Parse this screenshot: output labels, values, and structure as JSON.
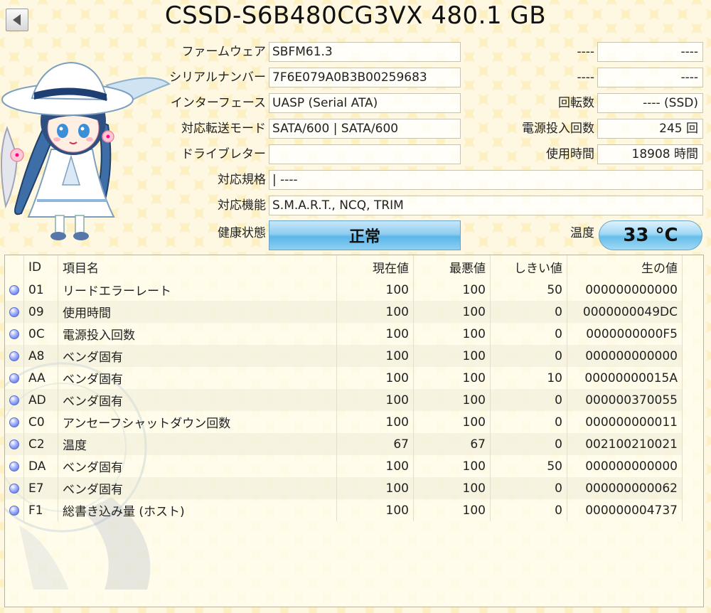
{
  "header": {
    "title": "CSSD-S6B480CG3VX 480.1 GB"
  },
  "info": {
    "firmware": {
      "label": "ファームウェア",
      "value": "SBFM61.3"
    },
    "serial": {
      "label": "シリアルナンバー",
      "value": "7F6E079A0B3B00259683"
    },
    "interface": {
      "label": "インターフェース",
      "value": "UASP (Serial ATA)"
    },
    "transfer_mode": {
      "label": "対応転送モード",
      "value": "SATA/600 | SATA/600"
    },
    "drive_letter": {
      "label": "ドライブレター",
      "value": ""
    },
    "standard": {
      "label": "対応規格",
      "value": " | ----"
    },
    "features": {
      "label": "対応機能",
      "value": "S.M.A.R.T., NCQ, TRIM"
    },
    "right1": {
      "label": "----",
      "value": "----"
    },
    "right2": {
      "label": "----",
      "value": "----"
    },
    "rotation": {
      "label": "回転数",
      "value": "---- (SSD)"
    },
    "power_on_count": {
      "label": "電源投入回数",
      "value": "245 回"
    },
    "power_on_hours": {
      "label": "使用時間",
      "value": "18908 時間"
    }
  },
  "health": {
    "label": "健康状態",
    "value": "正常",
    "color": "#5bb6e8"
  },
  "temperature": {
    "label": "温度",
    "value": "33 °C"
  },
  "smart": {
    "headers": {
      "id": "ID",
      "name": "項目名",
      "current": "現在値",
      "worst": "最悪値",
      "threshold": "しきい値",
      "raw": "生の値"
    },
    "rows": [
      {
        "id": "01",
        "name": "リードエラーレート",
        "current": "100",
        "worst": "100",
        "threshold": "50",
        "raw": "000000000000"
      },
      {
        "id": "09",
        "name": "使用時間",
        "current": "100",
        "worst": "100",
        "threshold": "0",
        "raw": "0000000049DC"
      },
      {
        "id": "0C",
        "name": "電源投入回数",
        "current": "100",
        "worst": "100",
        "threshold": "0",
        "raw": "0000000000F5"
      },
      {
        "id": "A8",
        "name": "ベンダ固有",
        "current": "100",
        "worst": "100",
        "threshold": "0",
        "raw": "000000000000"
      },
      {
        "id": "AA",
        "name": "ベンダ固有",
        "current": "100",
        "worst": "100",
        "threshold": "10",
        "raw": "00000000015A"
      },
      {
        "id": "AD",
        "name": "ベンダ固有",
        "current": "100",
        "worst": "100",
        "threshold": "0",
        "raw": "000000370055"
      },
      {
        "id": "C0",
        "name": "アンセーフシャットダウン回数",
        "current": "100",
        "worst": "100",
        "threshold": "0",
        "raw": "000000000011"
      },
      {
        "id": "C2",
        "name": "温度",
        "current": "67",
        "worst": "67",
        "threshold": "0",
        "raw": "002100210021"
      },
      {
        "id": "DA",
        "name": "ベンダ固有",
        "current": "100",
        "worst": "100",
        "threshold": "50",
        "raw": "000000000000"
      },
      {
        "id": "E7",
        "name": "ベンダ固有",
        "current": "100",
        "worst": "100",
        "threshold": "0",
        "raw": "000000000062"
      },
      {
        "id": "F1",
        "name": "総書き込み量 (ホスト)",
        "current": "100",
        "worst": "100",
        "threshold": "0",
        "raw": "000000004737"
      }
    ]
  }
}
